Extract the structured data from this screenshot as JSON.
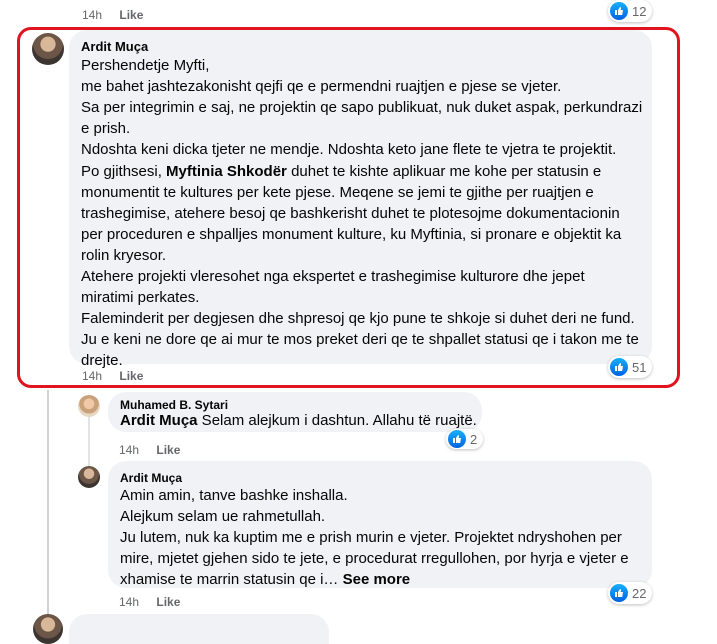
{
  "top_meta": {
    "time": "14h",
    "like": "Like",
    "reactions": "12"
  },
  "main_comment": {
    "author": "Ardit Muça",
    "paragraph1": [
      "Pershendetje Myfti,",
      "me bahet jashtezakonisht qejfi qe e permendni ruajtjen e pjese se vjeter.",
      "Sa per integrimin e saj, ne projektin qe sapo publikuat, nuk duket aspak, perkundrazi",
      "e prish.",
      "Ndoshta keni dicka tjeter ne mendje. Ndoshta keto jane flete te vjetra te projektit."
    ],
    "p2_line1_pre": "Po gjithsesi, ",
    "p2_line1_tag": "Myftinia Shkodër",
    "p2_line1_post": " duhet te kishte aplikuar me kohe per statusin e",
    "paragraph2_rest": [
      "monumentit te kultures per kete pjese. Meqene se jemi te gjithe per ruajtjen e",
      "trashegimise, atehere besoj qe bashkerisht duhet te plotesojme dokumentacionin",
      "per proceduren e shpalljes monument kulture, ku Myftinia, si pronare e objektit ka",
      "rolin kryesor.",
      "Atehere projekti vleresohet nga ekspertet e trashegimise kulturore dhe jepet",
      "miratimi perkates.",
      "Faleminderit per degjesen dhe shpresoj qe kjo pune te shkoje si duhet deri ne fund.",
      "Ju e keni ne dore qe ai mur te mos preket deri qe te shpallet statusi qe i takon me te",
      "drejte."
    ],
    "time": "14h",
    "like": "Like",
    "reactions": "51"
  },
  "reply1": {
    "author": "Muhamed B. Sytari",
    "tag": "Ardit Muça",
    "text": " Selam alejkum i dashtun. Allahu të ruajtë.",
    "time": "14h",
    "like": "Like",
    "reactions": "2"
  },
  "reply2": {
    "author": "Ardit Muça",
    "lines": [
      "Amin amin, tanve bashke inshalla.",
      "Alejkum selam ue rahmetullah.",
      "Ju lutem, nuk ka kuptim me e prish murin e vjeter. Projektet ndryshohen per",
      "mire, mjetet gjehen sido te jete, e procedurat rregullohen, por hyrja e vjeter e"
    ],
    "last_line": "xhamise te marrin statusin qe i…",
    "see_more": "See more",
    "time": "14h",
    "like": "Like",
    "reactions": "22"
  },
  "colors": {
    "highlight": "#e0141e",
    "bubble": "#f0f2f5",
    "like_blue": "#0866ff"
  }
}
